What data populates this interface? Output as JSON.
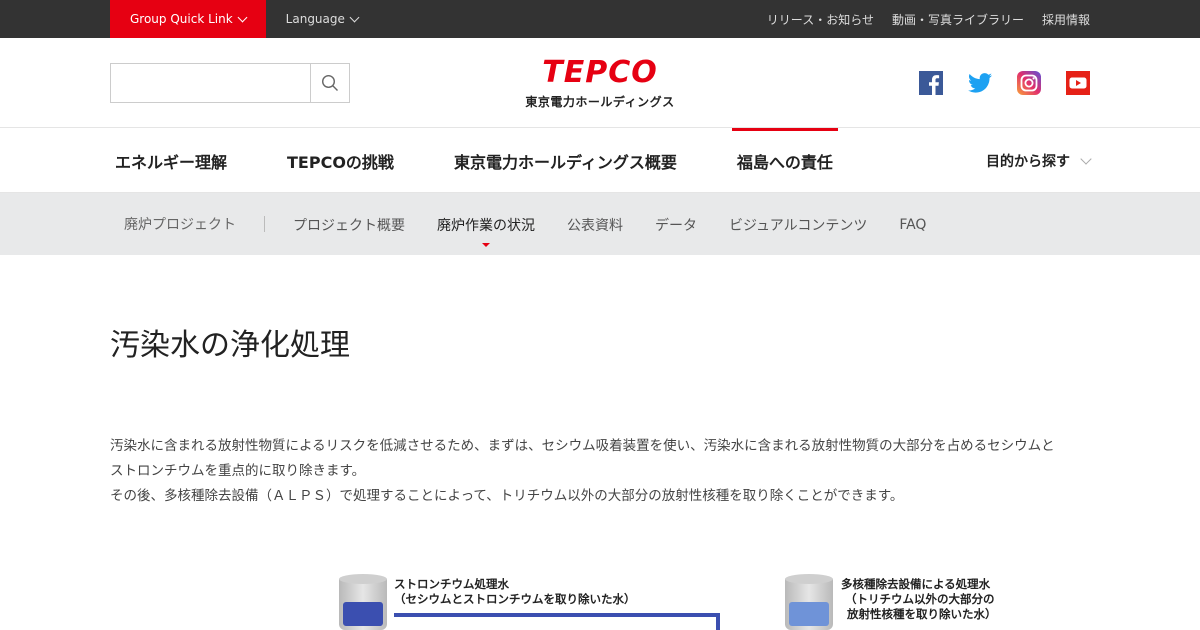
{
  "topbar": {
    "group_quick_link": "Group Quick Link",
    "language": "Language",
    "links": [
      "リリース・お知らせ",
      "動画・写真ライブラリー",
      "採用情報"
    ]
  },
  "header": {
    "search_placeholder": "",
    "logo_mark": "TEPCO",
    "logo_sub": "東京電力ホールディングス",
    "social": [
      "facebook-icon",
      "twitter-icon",
      "instagram-icon",
      "youtube-icon"
    ]
  },
  "mainnav": {
    "items": [
      "エネルギー理解",
      "TEPCOの挑戦",
      "東京電力ホールディングス概要",
      "福島への責任"
    ],
    "active_index": 3,
    "find": "目的から探す"
  },
  "subnav": {
    "section": "廃炉プロジェクト",
    "links": [
      "プロジェクト概要",
      "廃炉作業の状況",
      "公表資料",
      "データ",
      "ビジュアルコンテンツ",
      "FAQ"
    ],
    "active_index": 1
  },
  "content": {
    "title": "汚染水の浄化処理",
    "intro_lines": [
      "汚染水に含まれる放射性物質によるリスクを低減させるため、まずは、セシウム吸着装置を使い、汚染水に含まれる放射性物質の大部分を占めるセシウムと",
      "ストロンチウムを重点的に取り除きます。",
      "その後、多核種除去設備（ＡＬＰＳ）で処理することによって、トリチウム以外の大部分の放射性核種を取り除くことができます。"
    ]
  },
  "diagram": {
    "tank1_label": [
      "ストロンチウム処理水",
      "（セシウムとストロンチウムを取り除いた水）"
    ],
    "tank2_label": [
      "多核種除去設備による処理水",
      "（トリチウム以外の大部分の",
      "放射性核種を取り除いた水）"
    ]
  },
  "colors": {
    "brand_red": "#e60012",
    "topbar_bg": "#333333",
    "subnav_bg": "#e8e9ea",
    "water_dark": "#3b4fb0",
    "water_light": "#6f93d8"
  }
}
